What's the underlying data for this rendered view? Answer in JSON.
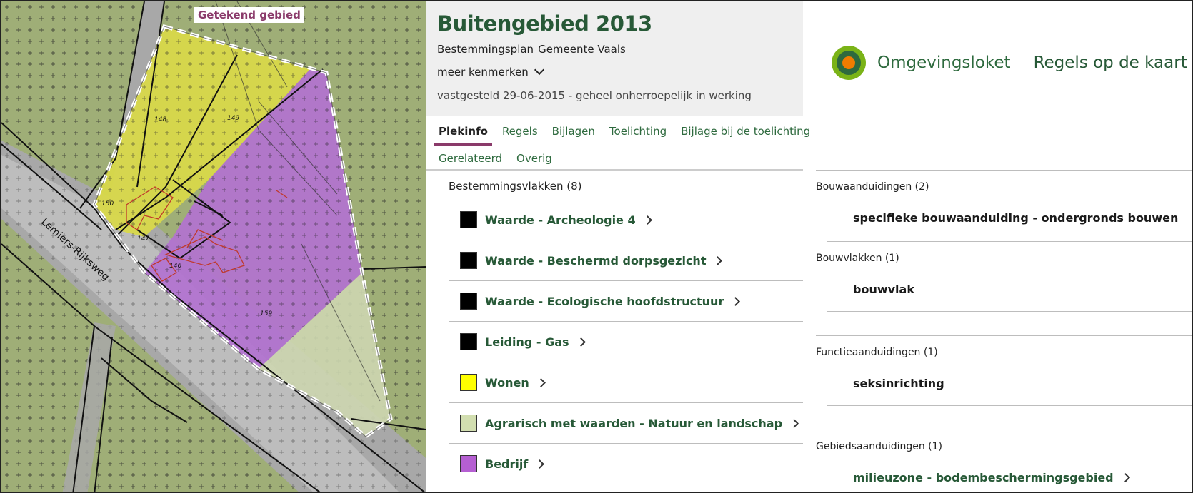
{
  "map": {
    "label": "Getekend gebied",
    "road_name": "Lemiers-Rijksweg",
    "parcel_numbers": [
      "148",
      "149",
      "150",
      "147",
      "146",
      "159"
    ]
  },
  "plan": {
    "title": "Buitengebied 2013",
    "type": "Bestemmingsplan",
    "municipality": "Gemeente Vaals",
    "more_label": "meer kenmerken",
    "status": "vastgesteld 29-06-2015 - geheel onherroepelijk in werking",
    "tabs": [
      {
        "label": "Plekinfo",
        "active": true
      },
      {
        "label": "Regels"
      },
      {
        "label": "Bijlagen"
      },
      {
        "label": "Toelichting"
      },
      {
        "label": "Bijlage bij de toelichting"
      },
      {
        "label": "Gerelateerd"
      },
      {
        "label": "Overig"
      }
    ],
    "section_title": "Bestemmingsvlakken (8)",
    "items": [
      {
        "label": "Waarde - Archeologie 4",
        "color": "#000000"
      },
      {
        "label": "Waarde - Beschermd dorpsgezicht",
        "color": "#000000"
      },
      {
        "label": "Waarde - Ecologische hoofdstructuur",
        "color": "#000000"
      },
      {
        "label": "Leiding - Gas",
        "color": "#000000"
      },
      {
        "label": "Wonen",
        "color": "#ffff00"
      },
      {
        "label": "Agrarisch met waarden - Natuur en landschap",
        "color": "#d2deb0"
      },
      {
        "label": "Bedrijf",
        "color": "#b55fd2"
      }
    ]
  },
  "brand": {
    "name": "Omgevingsloket",
    "tagline": "Regels op de kaart",
    "colors": {
      "outer": "#7ab317",
      "middle": "#2e6a3e",
      "inner": "#f07c00"
    }
  },
  "right": {
    "bouwaanduidingen": {
      "title": "Bouwaanduidingen (2)",
      "item": "specifieke bouwaanduiding - ondergronds bouwen"
    },
    "bouwvlakken": {
      "title": "Bouwvlakken (1)",
      "item": "bouwvlak"
    },
    "functieaanduidingen": {
      "title": "Functieaanduidingen (1)",
      "item": "seksinrichting"
    },
    "gebiedsaanduidingen": {
      "title": "Gebiedsaanduidingen (1)",
      "item": "milieuzone - bodembeschermingsgebied"
    }
  }
}
